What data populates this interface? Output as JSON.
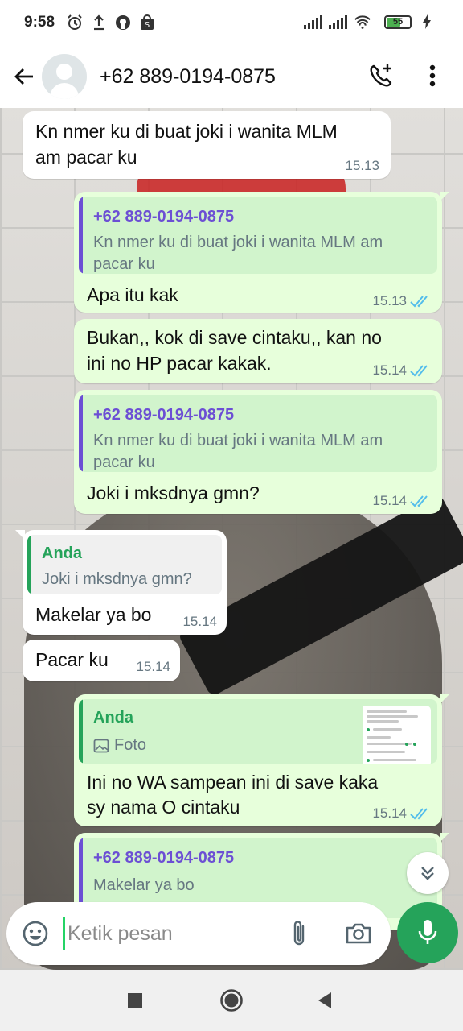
{
  "status_bar": {
    "time": "9:58",
    "battery": "55",
    "icons": [
      "alarm-icon",
      "upload-icon",
      "github-icon",
      "shop-icon",
      "signal-icon",
      "signal-icon",
      "wifi-icon",
      "battery-icon",
      "charging-icon"
    ]
  },
  "header": {
    "contact": "+62 889-0194-0875",
    "icons": [
      "back-arrow-icon",
      "avatar-icon",
      "add-call-icon",
      "more-vert-icon"
    ]
  },
  "messages": [
    {
      "type": "incoming",
      "text_line1": "Kn nmer ku di buat joki i wanita MLM",
      "text_line2": "am pacar ku",
      "time": "15.13"
    },
    {
      "type": "outgoing",
      "quote_name": "+62 889-0194-0875",
      "quote_line1": "Kn nmer ku di buat joki i wanita MLM am",
      "quote_line2": "pacar ku",
      "text": "Apa itu kak",
      "time": "15.13"
    },
    {
      "type": "outgoing",
      "text_line1": "Bukan,, kok di save cintaku,, kan no",
      "text_line2": "ini no HP pacar kakak.",
      "time": "15.14"
    },
    {
      "type": "outgoing",
      "quote_name": "+62 889-0194-0875",
      "quote_line1": "Kn nmer ku di buat joki i wanita MLM am",
      "quote_line2": "pacar ku",
      "text": "Joki i mksdnya gmn?",
      "time": "15.14"
    },
    {
      "type": "incoming",
      "quote_name": "Anda",
      "quote_line1": "Joki i mksdnya gmn?",
      "text": "Makelar ya bo",
      "time": "15.14"
    },
    {
      "type": "incoming",
      "text": "Pacar ku",
      "time": "15.14"
    },
    {
      "type": "outgoing",
      "quote_name": "Anda",
      "quote_media": "Foto",
      "text_line1": "Ini no WA sampean ini di save kaka",
      "text_line2": "sy nama O cintaku",
      "time": "15.14"
    },
    {
      "type": "outgoing",
      "quote_name": "+62 889-0194-0875",
      "quote_line1": "Makelar ya bo"
    }
  ],
  "composer": {
    "placeholder": "Ketik pesan",
    "icons": [
      "emoji-icon",
      "attach-icon",
      "camera-icon",
      "mic-icon"
    ]
  },
  "nav": {
    "icons": [
      "recents-icon",
      "home-icon",
      "back-icon"
    ]
  },
  "colors": {
    "outgoing_bubble": "#e7ffdb",
    "incoming_bubble": "#ffffff",
    "quote_contact_name": "#6c4fd4",
    "quote_self_name": "#25a35a",
    "read_ticks": "#53bdeb",
    "send_button": "#25a35a"
  }
}
